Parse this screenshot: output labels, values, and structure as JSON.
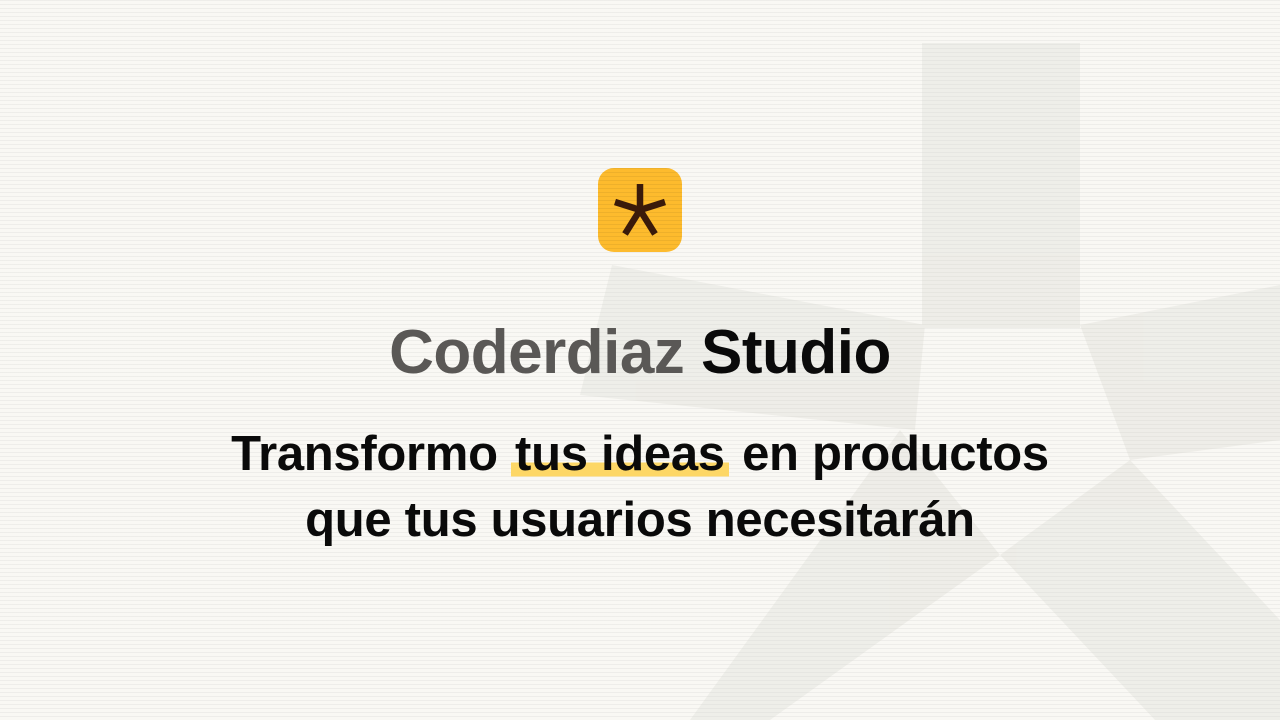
{
  "brand": {
    "name_first": "Coderdiaz",
    "name_second": "Studio",
    "logo_icon": "asterisk-icon"
  },
  "tagline": {
    "before": "Transformo",
    "highlight": "tus ideas",
    "after": "en productos",
    "line2": "que tus usuarios necesitarán"
  },
  "colors": {
    "background": "#f9f8f4",
    "accent": "#fdbb2d",
    "logo_glyph": "#3a1a0a",
    "highlight": "#fdd766",
    "text_primary": "#0a0a0a",
    "text_muted": "#5a5856"
  },
  "background_decoration": "asterisk-watermark-icon"
}
